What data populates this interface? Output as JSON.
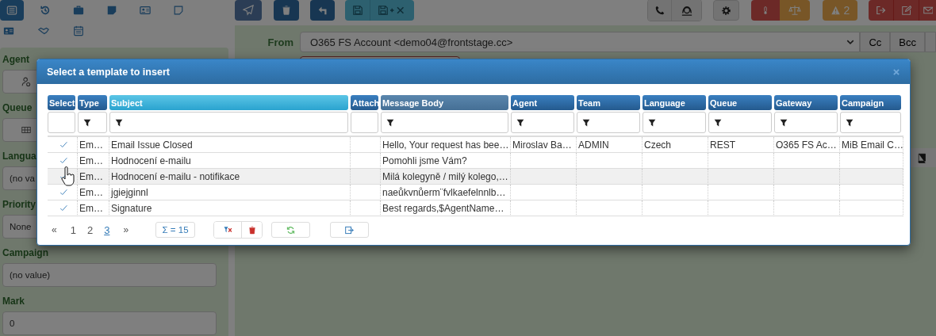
{
  "sidebar": {
    "tabs": [
      {
        "kind": "list",
        "selected": true
      },
      {
        "kind": "history",
        "selected": false
      },
      {
        "kind": "briefcase",
        "selected": false
      },
      {
        "kind": "note",
        "selected": false
      },
      {
        "kind": "id-card",
        "selected": false
      },
      {
        "kind": "sticky",
        "selected": false
      }
    ],
    "tabs_2": [
      {
        "kind": "contact-card",
        "selected": false
      },
      {
        "kind": "handshake",
        "selected": false
      },
      {
        "kind": "calendar",
        "selected": false
      }
    ],
    "fields": [
      {
        "label": "Agent",
        "kind": "users"
      },
      {
        "label": "Queue",
        "kind": "queue"
      },
      {
        "label": "Langua",
        "kind": "text",
        "value": "(no va"
      },
      {
        "label": "Priority",
        "kind": "text",
        "value": "None"
      },
      {
        "label": "Campaign",
        "kind": "text",
        "value": "(no value)"
      },
      {
        "label": "Mark",
        "kind": "text",
        "value": "0"
      }
    ]
  },
  "toolbar": {
    "alerts": "2"
  },
  "compose": {
    "from_label": "From",
    "from_value": "O365 FS Account <demo04@frontstage.cc>",
    "buttons": [
      "Cc",
      "Bcc"
    ]
  },
  "dialog": {
    "title": "Select a template to insert",
    "columns": [
      {
        "label": "Select",
        "kind": "normal",
        "filter": false
      },
      {
        "label": "Type",
        "kind": "normal",
        "filter": true
      },
      {
        "label": "Subject",
        "kind": "sorted",
        "filter": true
      },
      {
        "label": "Attach",
        "kind": "normal",
        "filter": false
      },
      {
        "label": "Message Body",
        "kind": "hover",
        "filter": true
      },
      {
        "label": "Agent",
        "kind": "normal",
        "filter": true
      },
      {
        "label": "Team",
        "kind": "normal",
        "filter": true
      },
      {
        "label": "Language",
        "kind": "normal",
        "filter": true
      },
      {
        "label": "Queue",
        "kind": "normal",
        "filter": true
      },
      {
        "label": "Gateway",
        "kind": "normal",
        "filter": true
      },
      {
        "label": "Campaign",
        "kind": "normal",
        "filter": true
      }
    ],
    "rows": [
      {
        "hovered": false,
        "type": "Em…",
        "subject": "Email Issue Closed",
        "message_body": "Hello, Your request has bee…",
        "agent": "Miroslav Ba…",
        "team": "ADMIN",
        "language": "Czech",
        "queue": "REST",
        "gateway": "O365 FS Ac…",
        "campaign": "MiB Email C…"
      },
      {
        "hovered": false,
        "type": "Em…",
        "subject": "Hodnocení e-mailu",
        "message_body": "Pomohli jsme Vám?"
      },
      {
        "hovered": true,
        "type": "Em…",
        "subject": "Hodnocení e-mailu - notifikace",
        "message_body": "Milá kolegyně / milý kolego,…"
      },
      {
        "hovered": false,
        "type": "Em…",
        "subject": "jgiejginnl",
        "message_body": "naeůkvnůerm¨fvlkaefelnnlb…"
      },
      {
        "hovered": false,
        "type": "Em…",
        "subject": "Signature",
        "message_body": "Best regards,$AgentName…"
      }
    ],
    "pager": {
      "first": "«",
      "last": "»",
      "pages": [
        {
          "label": "1",
          "selected": false
        },
        {
          "label": "2",
          "selected": false
        },
        {
          "label": "3",
          "selected": true
        }
      ]
    },
    "total": "Σ = 15"
  }
}
